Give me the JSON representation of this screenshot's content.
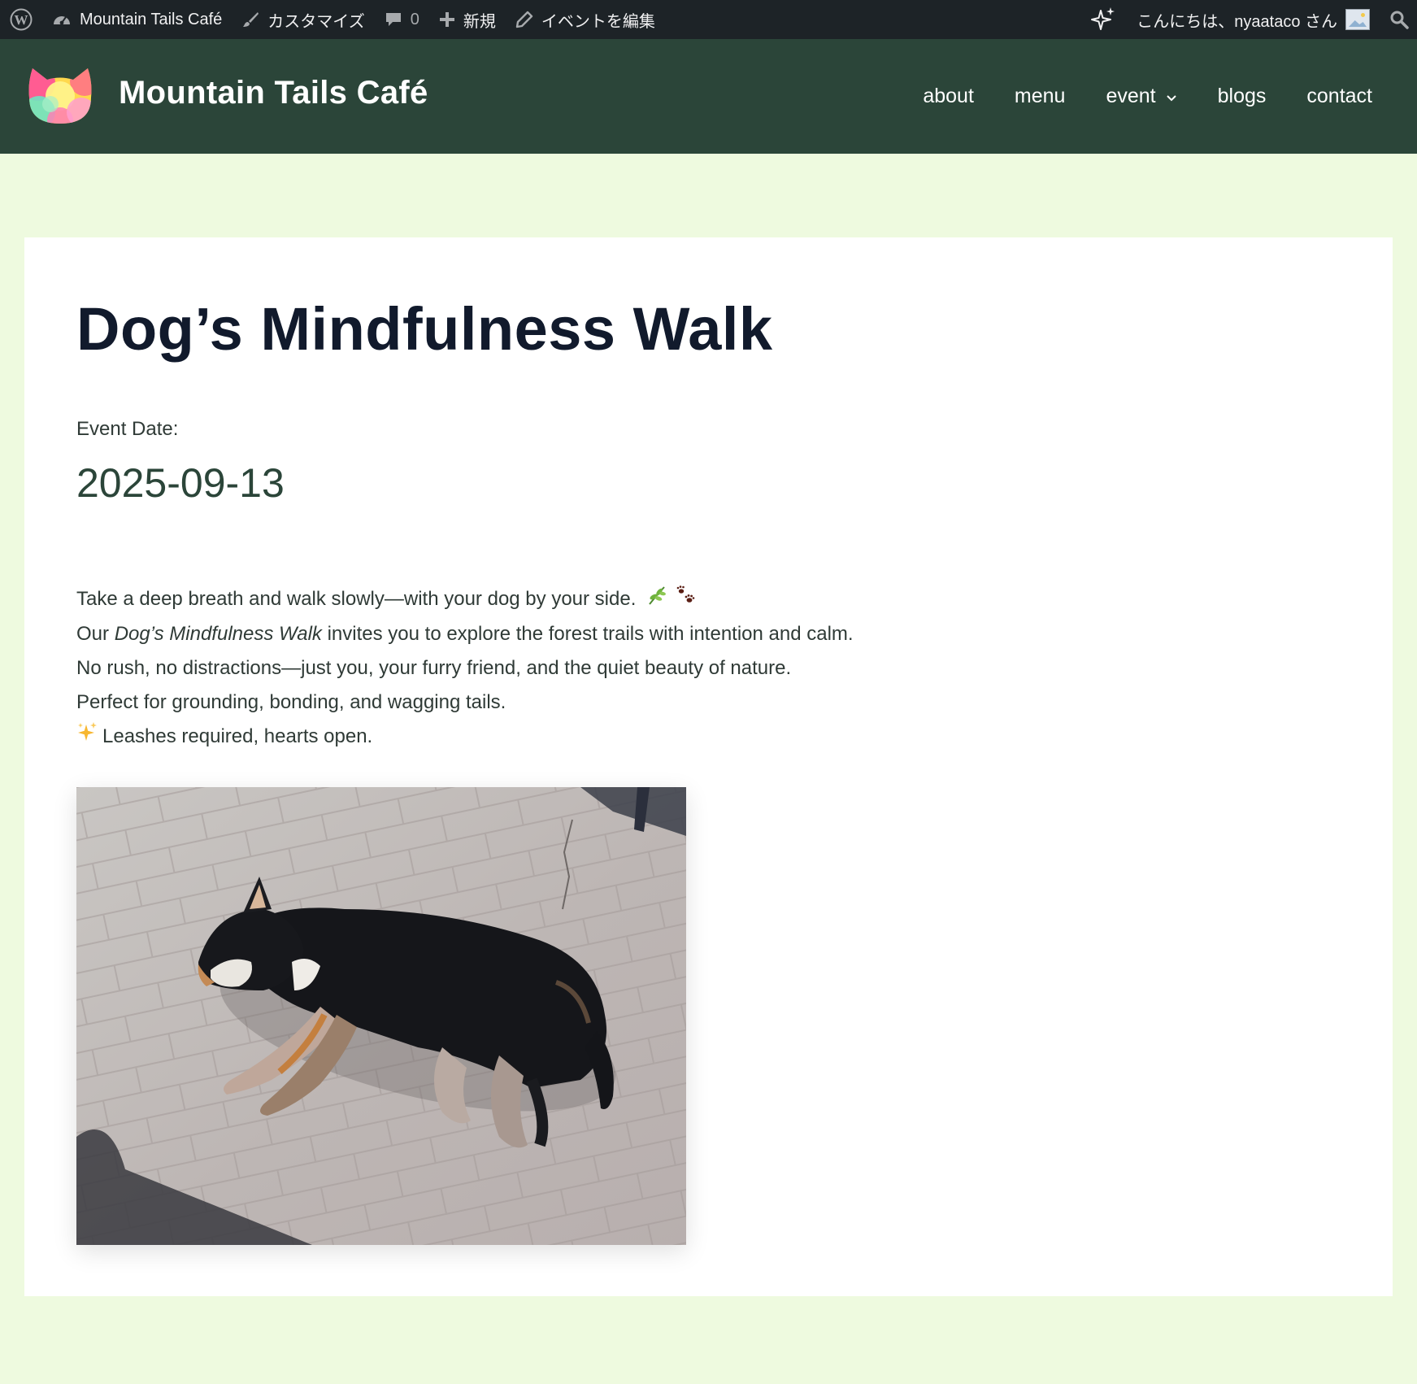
{
  "admin_bar": {
    "site_name": "Mountain Tails Café",
    "customize": "カスタマイズ",
    "comments_count": "0",
    "new": "新規",
    "edit": "イベントを編集",
    "greeting": "こんにちは、nyaataco さん"
  },
  "header": {
    "site_title": "Mountain Tails Café",
    "nav": [
      "about",
      "menu",
      "event",
      "blogs",
      "contact"
    ]
  },
  "post": {
    "title": "Dog’s Mindfulness Walk",
    "event_date_label": "Event Date:",
    "event_date": "2025-09-13",
    "line1": "Take a deep breath and walk slowly—with your dog by your side.",
    "line2_prefix": "Our ",
    "line2_em": "Dog’s Mindfulness Walk",
    "line2_suffix": " invites you to explore the forest trails with intention and calm.",
    "line3": "No rush, no distractions—just you, your furry friend, and the quiet beauty of nature.",
    "line4": "Perfect for grounding, bonding, and wagging tails.",
    "line5": "Leashes required, hearts open."
  },
  "icons": {
    "wordpress": "wordpress-icon",
    "dashboard": "dashboard-icon",
    "brush": "paintbrush-icon",
    "comment": "comment-icon",
    "plus": "plus-icon",
    "pencil": "pencil-icon",
    "sparkle": "sparkle-icon",
    "search": "search-icon"
  },
  "colors": {
    "admin_bar": "#1d2327",
    "header": "#2b4539",
    "page_bg": "#eefadf",
    "title": "#111a2c"
  }
}
